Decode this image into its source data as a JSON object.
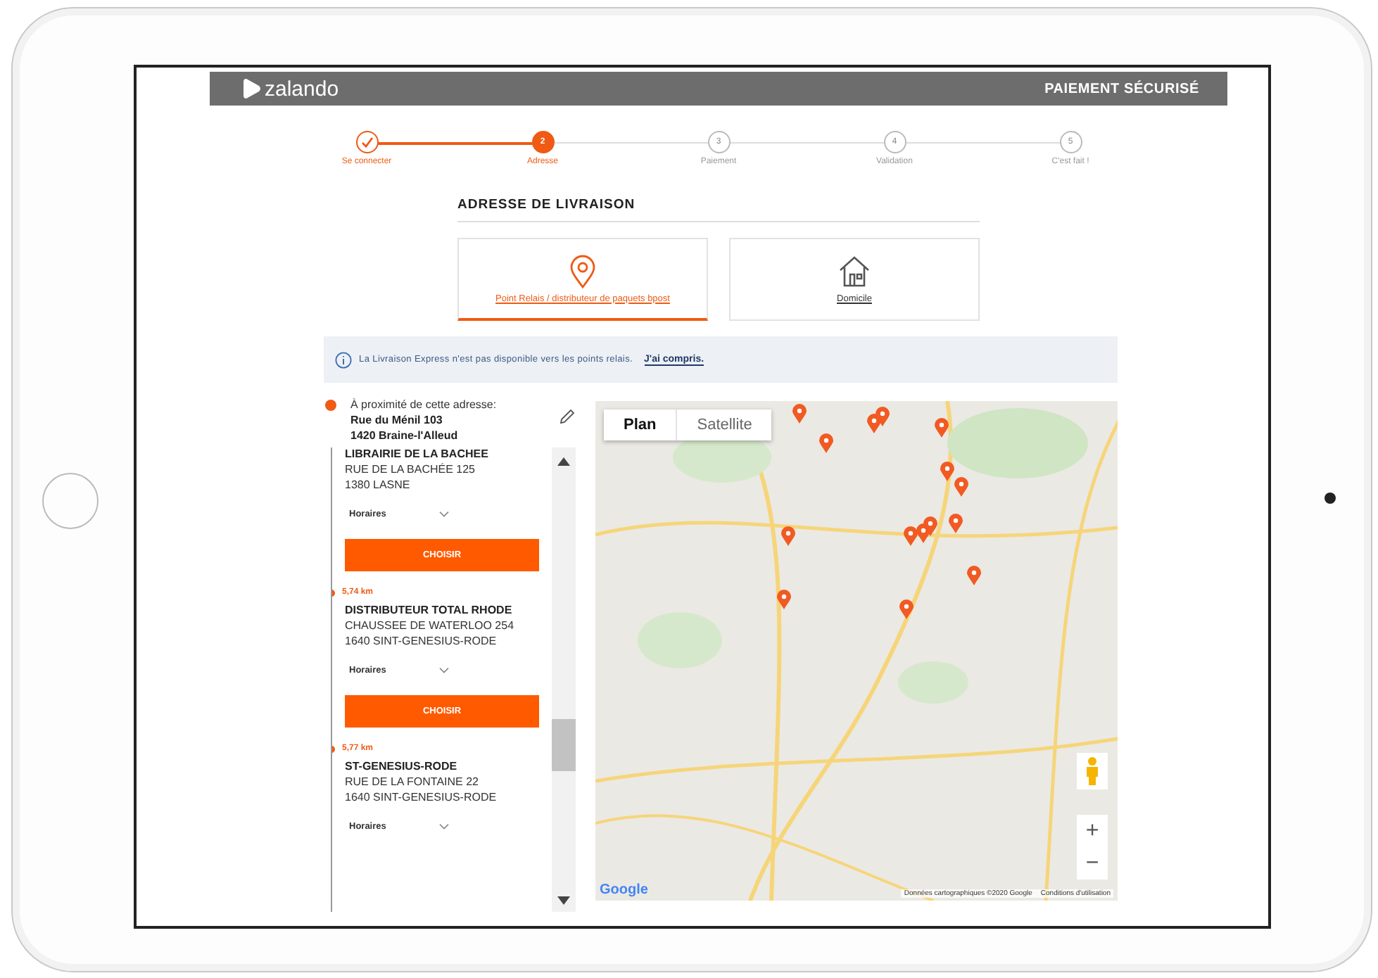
{
  "header": {
    "logo": "zalando",
    "secure": "PAIEMENT SÉCURISÉ"
  },
  "steps": [
    {
      "label": "Se connecter",
      "completed": true,
      "selected": false
    },
    {
      "number": "2",
      "label": "Adresse",
      "completed": false,
      "selected": true
    },
    {
      "number": "3",
      "label": "Paiement",
      "completed": false,
      "selected": false
    },
    {
      "number": "4",
      "label": "Validation",
      "completed": false,
      "selected": false
    },
    {
      "number": "5",
      "label": "C'est fait !",
      "completed": false,
      "selected": false
    }
  ],
  "section_title": "ADRESSE DE LIVRAISON",
  "delivery_options": [
    {
      "kind": "pin",
      "label": "Point Relais / distributeur de paquets bpost",
      "selected": true
    },
    {
      "kind": "house",
      "label": "Domicile",
      "selected": false
    }
  ],
  "notice": {
    "text": "La Livraison Express n'est pas disponible vers les points relais.",
    "link": "J'ai compris."
  },
  "origin": {
    "label": "À proximité de cette adresse:",
    "street": "Rue du Ménil 103",
    "city": "1420 Braine-l'Alleud"
  },
  "points": [
    {
      "name": "LIBRAIRIE DE LA BACHEE",
      "street": "RUE DE LA BACHÉE 125",
      "city": "1380 LASNE",
      "hours": "Horaires",
      "button": "CHOISIR"
    },
    {
      "distance": "5,74 km",
      "name": "DISTRIBUTEUR TOTAL RHODE",
      "street": "CHAUSSEE DE WATERLOO 254",
      "city": "1640 SINT-GENESIUS-RODE",
      "hours": "Horaires",
      "button": "CHOISIR"
    },
    {
      "distance": "5,77 km",
      "name": "ST-GENESIUS-RODE",
      "street": "RUE DE LA FONTAINE 22",
      "city": "1640 SINT-GENESIUS-RODE",
      "hours": "Horaires"
    }
  ],
  "map": {
    "tabs": [
      {
        "label": "Plan",
        "selected": true
      },
      {
        "label": "Satellite",
        "selected": false
      }
    ],
    "zoom_in": "+",
    "zoom_out": "−",
    "logo": "Google",
    "attribution": "Données cartographiques ©2020 Google",
    "terms": "Conditions d'utilisation"
  }
}
